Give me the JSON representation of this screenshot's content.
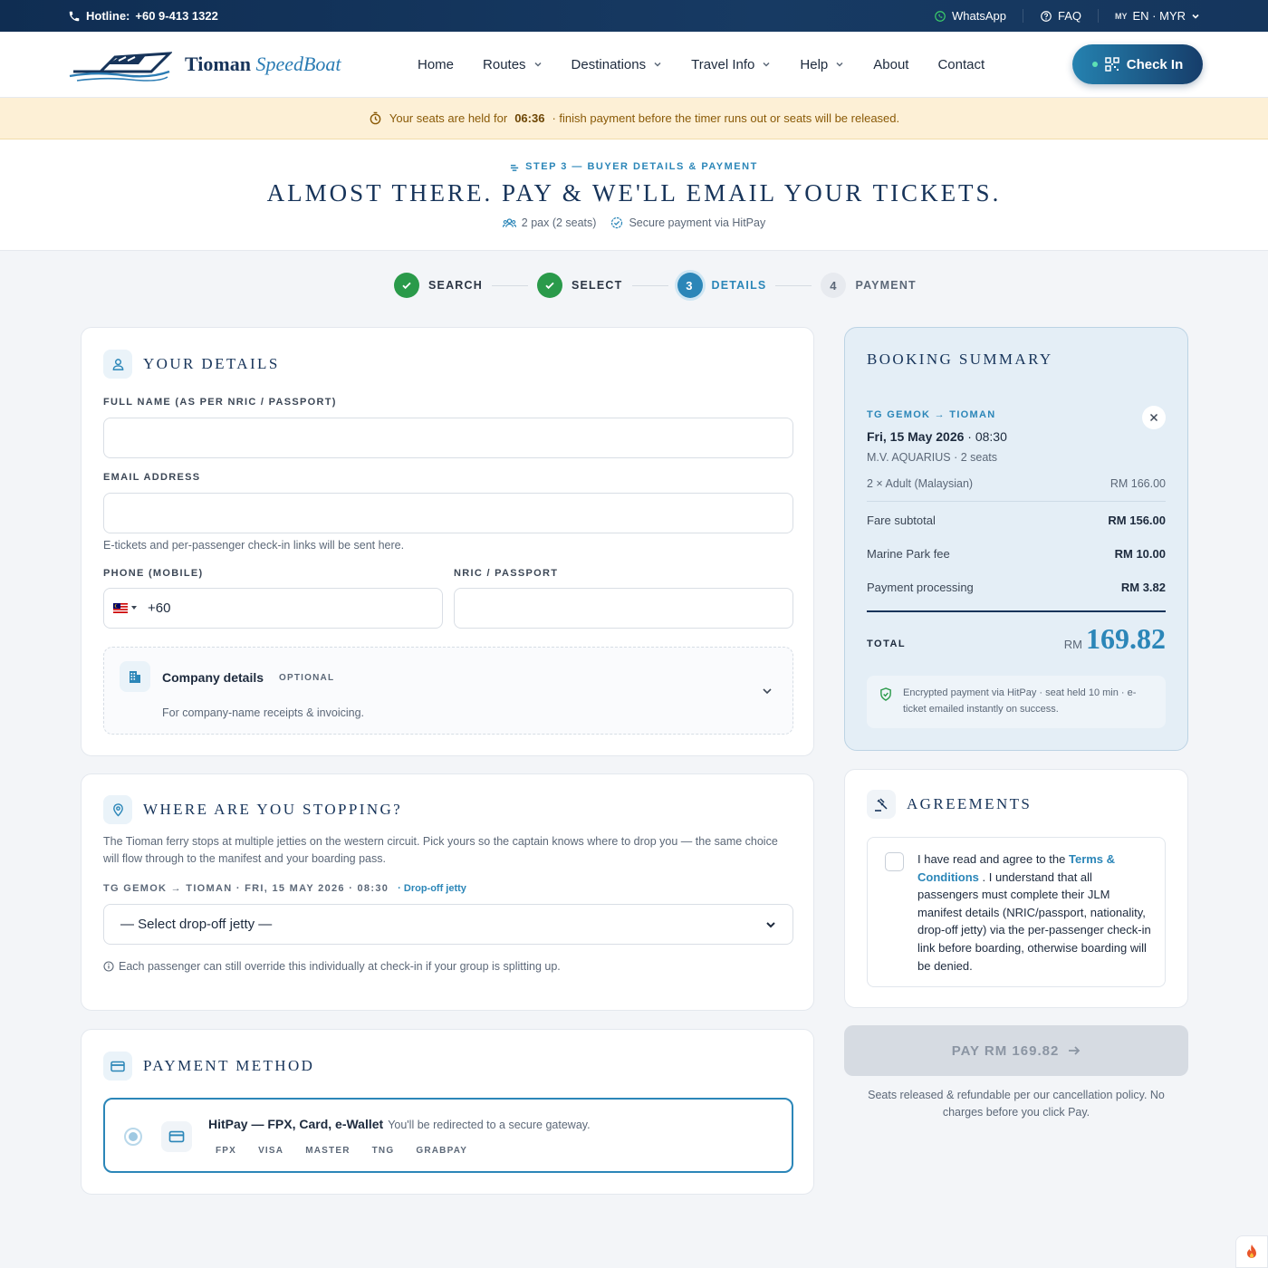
{
  "topbar": {
    "hotline_label": "Hotline:",
    "hotline_number": "+60 9-413 1322",
    "whatsapp": "WhatsApp",
    "faq": "FAQ",
    "locale_flag": "MY",
    "locale": "EN · MYR"
  },
  "header": {
    "brand_main": "Tioman",
    "brand_italic": "SpeedBoat",
    "nav": [
      {
        "label": "Home"
      },
      {
        "label": "Routes"
      },
      {
        "label": "Destinations"
      },
      {
        "label": "Travel Info"
      },
      {
        "label": "Help"
      },
      {
        "label": "About"
      },
      {
        "label": "Contact"
      }
    ],
    "checkin_label": "Check In"
  },
  "timer": {
    "prefix": "Your seats are held for",
    "time": "06:36",
    "suffix": "· finish payment before the timer runs out or seats will be released."
  },
  "hero": {
    "step": "STEP 3 — BUYER DETAILS & PAYMENT",
    "title": "ALMOST THERE. PAY & WE'LL EMAIL YOUR TICKETS.",
    "pax": "2 pax (2 seats)",
    "secure": "Secure payment via HitPay"
  },
  "stepper": [
    {
      "label": "SEARCH",
      "state": "done"
    },
    {
      "label": "SELECT",
      "state": "done"
    },
    {
      "label": "DETAILS",
      "state": "current",
      "num": "3"
    },
    {
      "label": "PAYMENT",
      "state": "todo",
      "num": "4"
    }
  ],
  "details": {
    "title": "YOUR DETAILS",
    "name_label": "FULL NAME (AS PER NRIC / PASSPORT)",
    "name_value": "",
    "email_label": "EMAIL ADDRESS",
    "email_value": "",
    "email_hint": "E-tickets and per-passenger check-in links will be sent here.",
    "phone_label": "PHONE (MOBILE)",
    "phone_prefix": "+60",
    "phone_value": "",
    "nric_label": "NRIC / PASSPORT",
    "nric_value": "",
    "company_title": "Company details",
    "company_badge": "OPTIONAL",
    "company_desc": "For company-name receipts & invoicing."
  },
  "stopping": {
    "title": "WHERE ARE YOU STOPPING?",
    "desc": "The Tioman ferry stops at multiple jetties on the western circuit. Pick yours so the captain knows where to drop you — the same choice will flow through to the manifest and your boarding pass.",
    "trip": "TG GEMOK → TIOMAN · FRI, 15 MAY 2026 · 08:30",
    "trip_tag": "· Drop-off jetty",
    "select_placeholder": "— Select drop-off jetty —",
    "note": "Each passenger can still override this individually at check-in if your group is splitting up."
  },
  "payment": {
    "title": "PAYMENT METHOD",
    "method": "HitPay — FPX, Card, e-Wallet",
    "method_note": "You'll be redirected to a secure gateway.",
    "chips": [
      "FPX",
      "VISA",
      "MASTER",
      "TNG",
      "GRABPAY"
    ]
  },
  "summary": {
    "title": "BOOKING SUMMARY",
    "route": "TG GEMOK → TIOMAN",
    "date": "Fri, 15 May 2026",
    "time": "· 08:30",
    "vessel": "M.V. AQUARIUS · 2 seats",
    "line_label": "2 × Adult (Malaysian)",
    "line_value": "RM 166.00",
    "fare_label": "Fare subtotal",
    "fare_value": "RM 156.00",
    "park_label": "Marine Park fee",
    "park_value": "RM 10.00",
    "proc_label": "Payment processing",
    "proc_value": "RM 3.82",
    "total_label": "TOTAL",
    "total_currency": "RM",
    "total_value": "169.82",
    "secure_note": "Encrypted payment via HitPay · seat held 10 min · e-ticket emailed instantly on success."
  },
  "agreements": {
    "title": "AGREEMENTS",
    "text_before": "I have read and agree to the",
    "link": "Terms & Conditions",
    "text_after": ". I understand that all passengers must complete their JLM manifest details (NRIC/passport, nationality, drop-off jetty) via the per-passenger check-in link before boarding, otherwise boarding will be denied."
  },
  "pay": {
    "button": "PAY RM 169.82",
    "note": "Seats released & refundable per our cancellation policy. No charges before you click Pay."
  },
  "colors": {
    "navy": "#17345a",
    "accent": "#2b86b8",
    "success": "#2a9a4a",
    "banner": "#fdf0d6"
  }
}
